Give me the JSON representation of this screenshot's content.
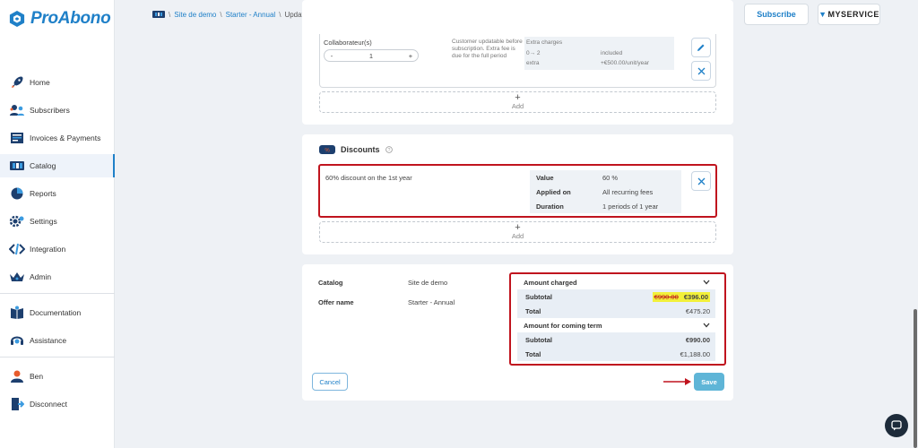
{
  "brand": {
    "name": "ProAbono",
    "accent": "#1f80c8"
  },
  "sidebar": {
    "items": [
      {
        "label": "Home",
        "icon": "rocket-icon"
      },
      {
        "label": "Subscribers",
        "icon": "users-icon"
      },
      {
        "label": "Invoices & Payments",
        "icon": "invoice-icon"
      },
      {
        "label": "Catalog",
        "icon": "catalog-icon",
        "active": true
      },
      {
        "label": "Reports",
        "icon": "pie-chart-icon"
      },
      {
        "label": "Settings",
        "icon": "gear-icon"
      },
      {
        "label": "Integration",
        "icon": "code-icon"
      },
      {
        "label": "Admin",
        "icon": "crown-icon"
      }
    ],
    "help_items": [
      {
        "label": "Documentation",
        "icon": "book-icon"
      },
      {
        "label": "Assistance",
        "icon": "headset-icon"
      }
    ],
    "user_items": [
      {
        "label": "Ben",
        "icon": "user-icon"
      },
      {
        "label": "Disconnect",
        "icon": "logout-icon"
      }
    ]
  },
  "breadcrumb": {
    "seg1": "Site de demo",
    "seg2": "Starter - Annual",
    "current": "Update an offer"
  },
  "header": {
    "subscribe_label": "Subscribe",
    "partner": "MYSERVICE"
  },
  "feature": {
    "name": "Collaborateur(s)",
    "quantity": "1",
    "minus": "-",
    "plus": "+",
    "note": "Customer updatable before subscription. Extra fee is due for the full period",
    "charges_title": "Extra charges",
    "range": "0→ 2",
    "range_value": "included",
    "extra": "extra",
    "extra_value": "+€500.00/unit/year"
  },
  "add_label": "Add",
  "discounts": {
    "title": "Discounts",
    "description": "60% discount on the 1st year",
    "rows": [
      {
        "label": "Value",
        "value": "60 %"
      },
      {
        "label": "Applied on",
        "value": "All recurring fees"
      },
      {
        "label": "Duration",
        "value": "1 periods of 1 year"
      }
    ]
  },
  "summary": {
    "catalog_label": "Catalog",
    "catalog_value": "Site de demo",
    "offer_label": "Offer name",
    "offer_value": "Starter - Annual",
    "amount_charged": "Amount charged",
    "subtotal_label": "Subtotal",
    "subtotal_old": "€990.00",
    "subtotal_new": "€396.00",
    "total_label": "Total",
    "total_value": "€475.20",
    "coming_term": "Amount for coming term",
    "coming_subtotal": "€990.00",
    "coming_total": "€1,188.00"
  },
  "actions": {
    "cancel": "Cancel",
    "save": "Save"
  },
  "colors": {
    "highlight_border": "#c0141e",
    "highlight_marker": "#f2f03a",
    "save_bg": "#5fb5d7"
  }
}
